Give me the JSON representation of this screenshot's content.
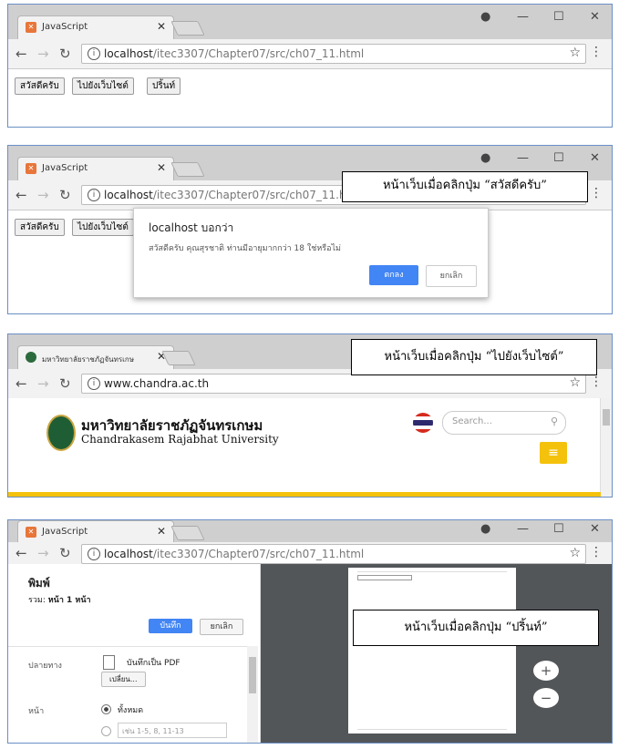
{
  "panels": [
    {
      "tab_title": "JavaScript",
      "url_host": "localhost",
      "url_path": "/itec3307/Chapter07/src/ch07_11.html",
      "buttons": [
        "สวัสดีครับ",
        "ไปยังเว็บไซต์",
        "ปริ้นท์"
      ]
    },
    {
      "tab_title": "JavaScript",
      "url_host": "localhost",
      "url_path": "/itec3307/Chapter07/src/ch07_11.html",
      "buttons": [
        "สวัสดีครับ",
        "ไปยังเว็บไซต์"
      ],
      "callout": "หน้าเว็บเมื่อคลิกปุ่ม “สวัสดีครับ”",
      "dialog": {
        "title": "localhost บอกว่า",
        "message": "สวัสดีครับ คุณสุรชาติ ท่านมีอายุมากกว่า 18 ใช่หรือไม่",
        "ok": "ตกลง",
        "cancel": "ยกเลิก"
      }
    },
    {
      "tab_title": "มหาวิทยาลัยราชภัฏจันทรเกษ",
      "url": "www.chandra.ac.th",
      "callout": "หน้าเว็บเมื่อคลิกปุ่ม “ไปยังเว็บไซต์”",
      "site_name_th": "มหาวิทยาลัยราชภัฏจันทรเกษม",
      "site_name_en": "Chandrakasem Rajabhat University",
      "search_placeholder": "Search..."
    },
    {
      "tab_title": "JavaScript",
      "url_host": "localhost",
      "url_path": "/itec3307/Chapter07/src/ch07_11.html",
      "callout": "หน้าเว็บเมื่อคลิกปุ่ม “ปริ้นท์”",
      "print": {
        "heading": "พิมพ์",
        "total_label": "รวม:",
        "total_value": "หน้า 1 หน้า",
        "save": "บันทึก",
        "cancel": "ยกเลิก",
        "destination_label": "ปลายทาง",
        "destination_value": "บันทึกเป็น PDF",
        "change": "เปลี่ยน...",
        "pages_label": "หน้า",
        "all_pages": "ทั้งหมด",
        "range_placeholder": "เช่น 1-5, 8, 11-13"
      }
    }
  ]
}
